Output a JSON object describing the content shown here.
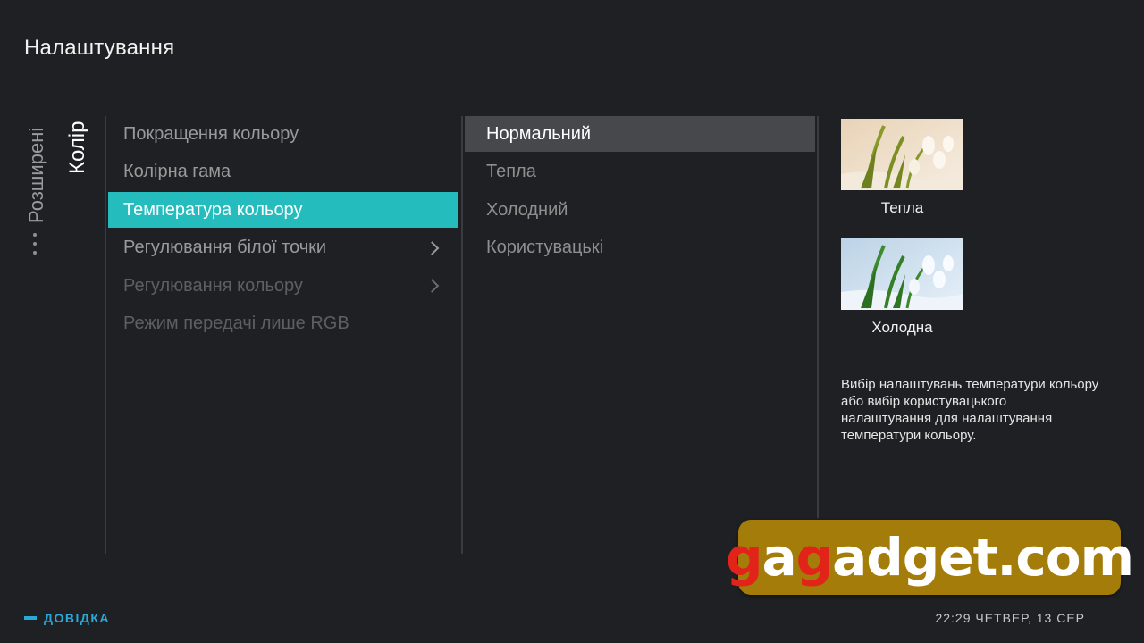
{
  "header": {
    "title": "Налаштування"
  },
  "breadcrumb": {
    "previous": "Розширені",
    "current": "Колір"
  },
  "menu": {
    "items": [
      {
        "label": "Покращення кольору",
        "state": "normal",
        "submenu": false
      },
      {
        "label": "Колірна гама",
        "state": "normal",
        "submenu": false
      },
      {
        "label": "Температура кольору",
        "state": "selected",
        "submenu": false
      },
      {
        "label": "Регулювання білої точки",
        "state": "normal",
        "submenu": true
      },
      {
        "label": "Регулювання кольору",
        "state": "disabled",
        "submenu": true
      },
      {
        "label": "Режим передачі лише RGB",
        "state": "disabled",
        "submenu": false
      }
    ]
  },
  "options": {
    "items": [
      {
        "label": "Нормальний",
        "focused": true
      },
      {
        "label": "Тепла",
        "focused": false
      },
      {
        "label": "Холодний",
        "focused": false
      },
      {
        "label": "Користувацькі",
        "focused": false
      }
    ]
  },
  "preview": {
    "warm_caption": "Тепла",
    "cold_caption": "Холодна",
    "description": "Вибір налаштувань температури кольору або вибір користувацького налаштування для налаштування температури кольору."
  },
  "watermark": {
    "part1": "g",
    "part2": "a",
    "part3": "g",
    "part4": "adget.com"
  },
  "footer": {
    "help_label": "ДОВІДКА",
    "clock": "22:29 ЧЕТВЕР, 13 СЕР"
  },
  "colors": {
    "background": "#1f2023",
    "selected": "#24bcbd",
    "focused": "#47484b",
    "help_accent": "#29a9d8",
    "watermark_bg": "#a47c0a",
    "watermark_red": "#e2231a"
  }
}
